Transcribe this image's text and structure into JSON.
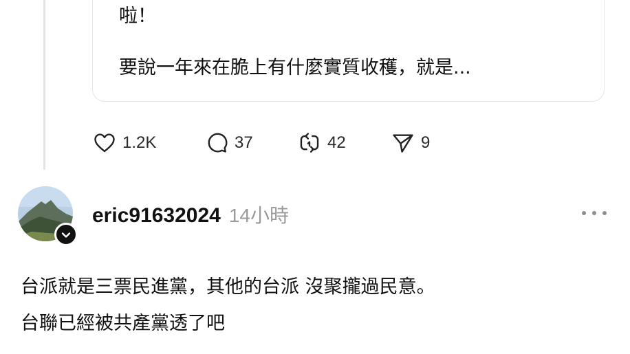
{
  "quoted_post": {
    "line1": "啦！",
    "line2": "要說一年來在脆上有什麼實質收穫，就是..."
  },
  "actions": {
    "like_count": "1.2K",
    "reply_count": "37",
    "repost_count": "42",
    "share_count": "9"
  },
  "icons": {
    "like": "heart-icon",
    "reply": "speech-bubble-icon",
    "repost": "repost-arrows-icon",
    "share": "paper-plane-icon",
    "more": "more-dots-icon",
    "follow_badge": "chevron-down-icon"
  },
  "reply_post": {
    "username": "eric91632024",
    "timestamp": "14小時",
    "line1": "台派就是三票民進黨，其他的台派 沒聚攏過民意。",
    "line2": "台聯已經被共產黨透了吧"
  },
  "colors": {
    "text": "#111111",
    "secondary_text": "#9a9a9a",
    "border": "#e6e6e6",
    "background": "#ffffff"
  }
}
